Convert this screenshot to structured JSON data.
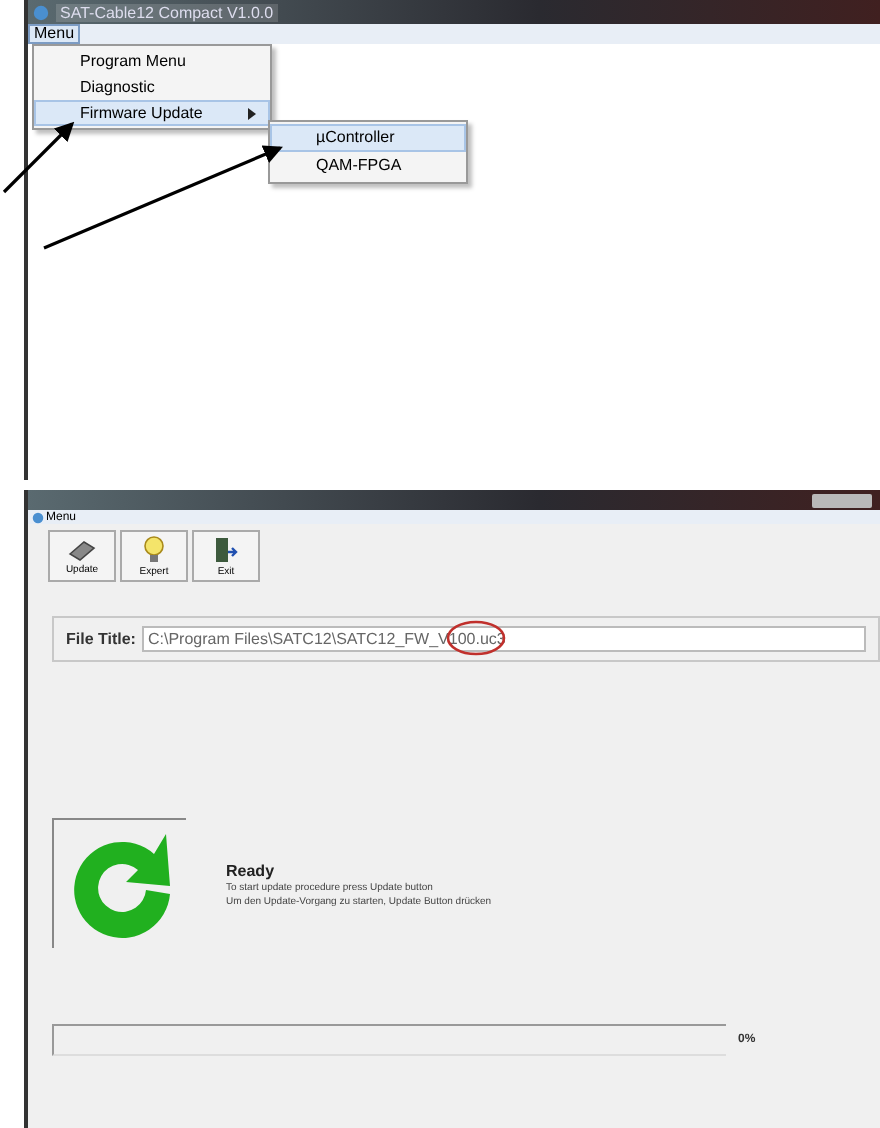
{
  "top_window": {
    "title": "SAT-Cable12 Compact V1.0.0",
    "menu_bar": [
      "Menu"
    ],
    "menu": [
      {
        "label": "Program Menu",
        "has_submenu": false,
        "selected": false
      },
      {
        "label": "Diagnostic",
        "has_submenu": false,
        "selected": false
      },
      {
        "label": "Firmware Update",
        "has_submenu": true,
        "selected": true
      }
    ],
    "submenu": [
      {
        "label": "µController",
        "selected": true
      },
      {
        "label": "QAM-FPGA",
        "selected": false
      }
    ]
  },
  "bottom_window": {
    "menu_bar": [
      "Menu"
    ],
    "toolbar": [
      {
        "label": "Update",
        "kind": "chip"
      },
      {
        "label": "Expert",
        "kind": "bulb"
      },
      {
        "label": "Exit",
        "kind": "door"
      }
    ],
    "file_title": {
      "label": "File Title:",
      "value": "C:\\Program Files\\SATC12\\SATC12_FW_V100.uc3"
    },
    "status": {
      "title": "Ready",
      "lines": [
        "To start update procedure press Update button",
        "Um den Update-Vorgang zu starten, Update Button drücken"
      ]
    },
    "progress": {
      "level": 0,
      "reading": "0%"
    }
  }
}
